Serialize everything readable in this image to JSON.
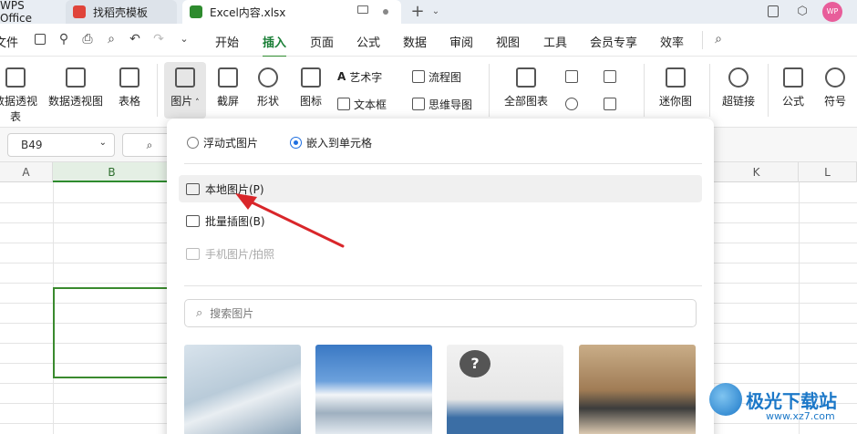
{
  "tabs": [
    {
      "label": "WPS Office"
    },
    {
      "label": "找稻壳模板"
    },
    {
      "label": "Excel内容.xlsx"
    }
  ],
  "user_avatar": "WP",
  "menu": {
    "file": "文件",
    "items": [
      "开始",
      "插入",
      "页面",
      "公式",
      "数据",
      "审阅",
      "视图",
      "工具",
      "会员专享",
      "效率"
    ],
    "active": "插入"
  },
  "ribbon": {
    "pivot_chart": "数据透视表",
    "pivot_table": "数据透视图",
    "table": "表格",
    "picture": "图片",
    "screenshot": "截屏",
    "shape": "形状",
    "icon": "图标",
    "art_text": "艺术字",
    "text_box": "文本框",
    "flowchart": "流程图",
    "mind_map": "思维导图",
    "all_charts": "全部图表",
    "sparkline": "迷你图",
    "hyperlink": "超链接",
    "formula": "公式",
    "symbol": "符号"
  },
  "name_box": "B49",
  "columns": [
    "A",
    "B",
    "K",
    "L"
  ],
  "popup": {
    "radio_floating": "浮动式图片",
    "radio_embed": "嵌入到单元格",
    "local_picture": "本地图片(P)",
    "batch_insert": "批量插图(B)",
    "phone_picture": "手机图片/拍照",
    "search_placeholder": "搜索图片"
  },
  "watermark": {
    "cn": "极光下载站",
    "url": "www.xz7.com"
  },
  "colors": {
    "accent": "#2e8b2e",
    "arrow": "#d9262a",
    "radio": "#1f6fe0"
  }
}
